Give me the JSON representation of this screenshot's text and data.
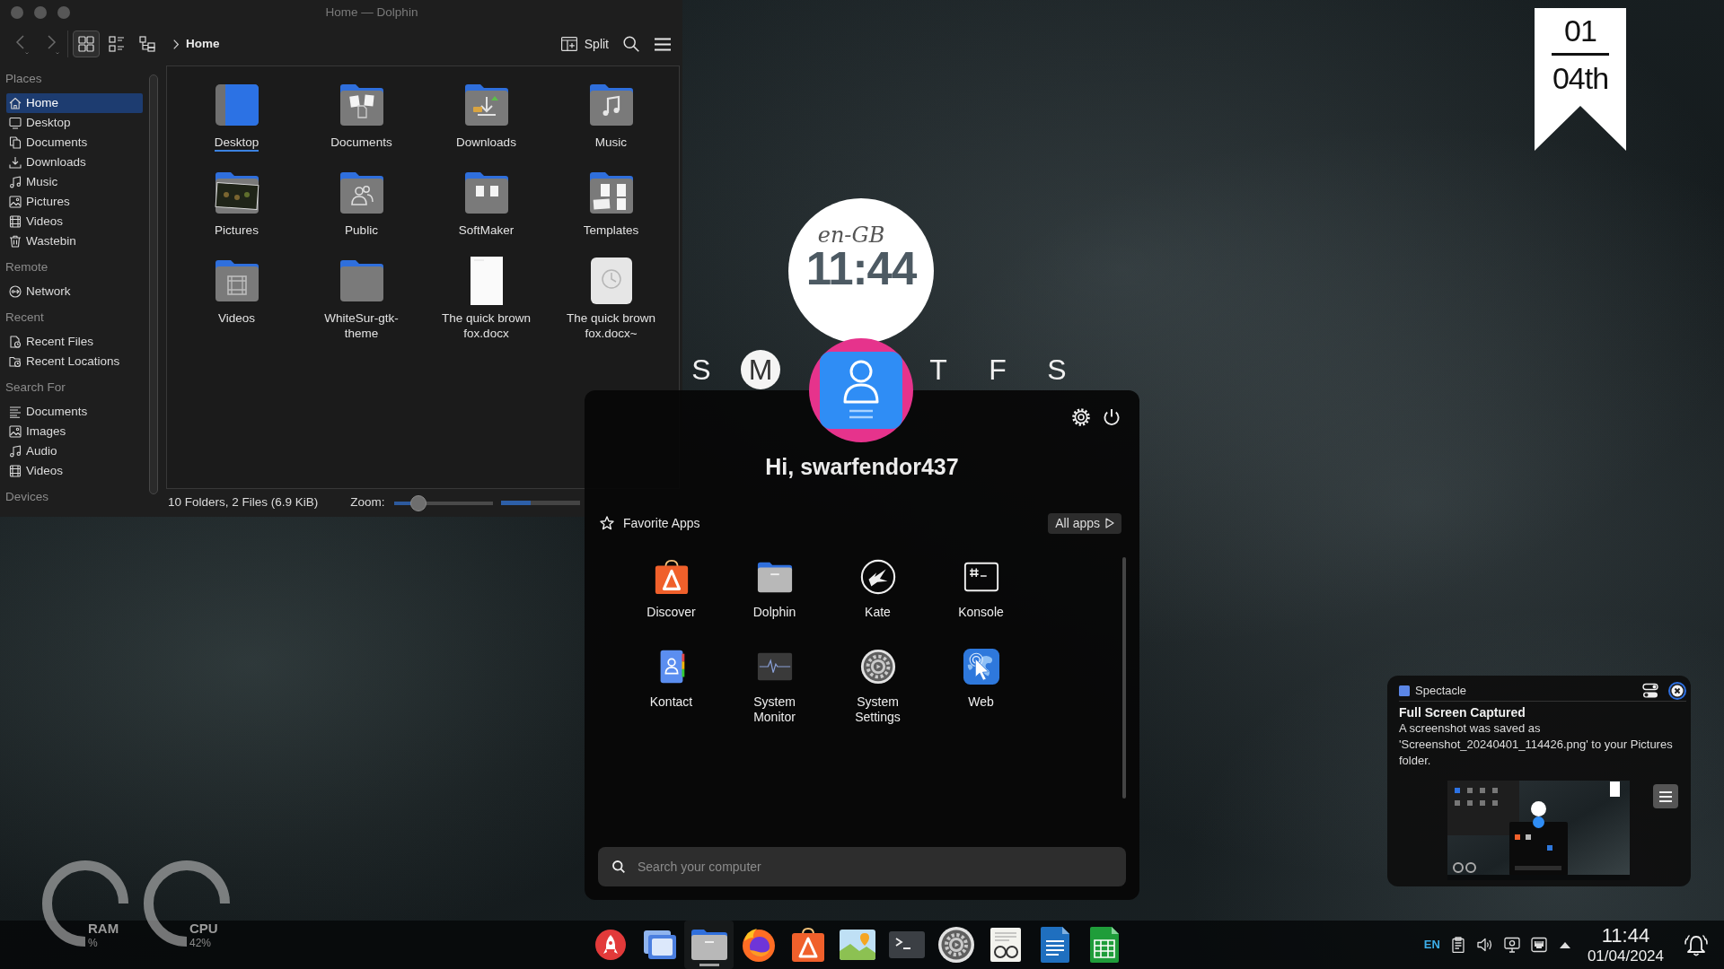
{
  "dolphin": {
    "title": "Home — Dolphin",
    "nav_buttons": [
      {
        "disabled": true
      },
      {
        "disabled": true
      }
    ],
    "view_modes": [
      {
        "selected": true
      },
      {
        "selected": false
      },
      {
        "selected": false
      }
    ],
    "breadcrumb": [
      "Home"
    ],
    "split_label": "Split",
    "sidebar": [
      {
        "title": "Places",
        "items": [
          {
            "label": "Home",
            "selected": true
          },
          {
            "label": "Desktop",
            "selected": false
          },
          {
            "label": "Documents",
            "selected": false
          },
          {
            "label": "Downloads",
            "selected": false
          },
          {
            "label": "Music",
            "selected": false
          },
          {
            "label": "Pictures",
            "selected": false
          },
          {
            "label": "Videos",
            "selected": false
          },
          {
            "label": "Wastebin",
            "selected": false
          }
        ]
      },
      {
        "title": "Remote",
        "items": [
          {
            "label": "Network",
            "selected": false
          }
        ]
      },
      {
        "title": "Recent",
        "items": [
          {
            "label": "Recent Files",
            "selected": false
          },
          {
            "label": "Recent Locations",
            "selected": false
          }
        ]
      },
      {
        "title": "Search For",
        "items": [
          {
            "label": "Documents",
            "selected": false
          },
          {
            "label": "Images",
            "selected": false
          },
          {
            "label": "Audio",
            "selected": false
          },
          {
            "label": "Videos",
            "selected": false
          }
        ]
      },
      {
        "title": "Devices"
      }
    ],
    "files": [
      {
        "name": "Desktop",
        "kind": "folder",
        "focused": true
      },
      {
        "name": "Documents",
        "kind": "folder",
        "focused": false
      },
      {
        "name": "Downloads",
        "kind": "folder",
        "focused": false
      },
      {
        "name": "Music",
        "kind": "folder",
        "focused": false
      },
      {
        "name": "Pictures",
        "kind": "folder",
        "focused": false
      },
      {
        "name": "Public",
        "kind": "folder",
        "focused": false
      },
      {
        "name": "SoftMaker",
        "kind": "folder",
        "focused": false
      },
      {
        "name": "Templates",
        "kind": "folder",
        "focused": false
      },
      {
        "name": "Videos",
        "kind": "folder",
        "focused": false
      },
      {
        "name": "WhiteSur-gtk-theme",
        "kind": "folder",
        "focused": false
      },
      {
        "name": "The quick brown fox.docx",
        "kind": "file",
        "focused": false
      },
      {
        "name": "The quick brown fox.docx~",
        "kind": "file",
        "focused": false
      }
    ],
    "status": "10 Folders, 2 Files (6.9 KiB)",
    "zoom": {
      "label": "Zoom:",
      "level": 0.25
    },
    "free_space": {
      "level": 0.38
    }
  },
  "clock_widget": {
    "locale": "en-GB",
    "time": "11:44"
  },
  "date_ribbon": {
    "upper": "01",
    "lower": "04th"
  },
  "week_days": {
    "left": [
      {
        "letter": "S",
        "selected": false
      },
      {
        "letter": "M",
        "selected": true
      }
    ],
    "right": [
      {
        "letter": "T",
        "selected": false
      },
      {
        "letter": "F",
        "selected": false
      },
      {
        "letter": "S",
        "selected": false
      }
    ]
  },
  "launcher": {
    "greeting": "Hi, swarfendor437",
    "favorites_title": "Favorite Apps",
    "all_apps_label": "All apps",
    "apps": [
      {
        "label": "Discover"
      },
      {
        "label": "Dolphin"
      },
      {
        "label": "Kate"
      },
      {
        "label": "Konsole"
      },
      {
        "label": "Kontact"
      },
      {
        "label": "System Monitor"
      },
      {
        "label": "System Settings"
      },
      {
        "label": "Web"
      }
    ],
    "search": {
      "placeholder": "Search your computer"
    }
  },
  "gauges": [
    {
      "label": "RAM",
      "reading": "%"
    },
    {
      "label": "CPU",
      "reading": "42%"
    }
  ],
  "taskbar": {
    "apps": [
      {
        "running": false
      },
      {
        "running": false
      },
      {
        "running": true
      },
      {
        "running": false
      },
      {
        "running": false
      },
      {
        "running": false
      },
      {
        "running": false
      },
      {
        "running": false
      },
      {
        "running": false
      },
      {
        "running": false
      },
      {
        "running": false
      }
    ],
    "language": "EN",
    "clock": {
      "time": "11:44",
      "date": "01/04/2024"
    }
  },
  "notification": {
    "app": "Spectacle",
    "title": "Full Screen Captured",
    "body": "A screenshot was saved as 'Screenshot_20240401_114426.png' to your Pictures folder."
  }
}
